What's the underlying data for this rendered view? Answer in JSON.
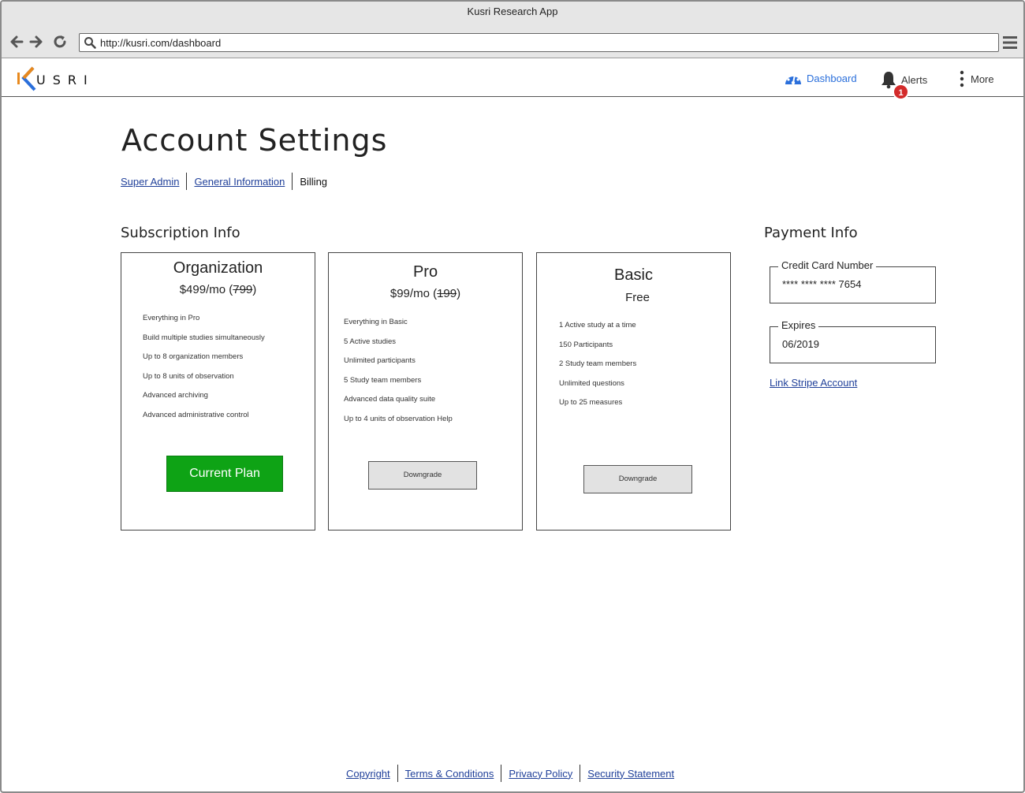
{
  "window": {
    "title": "Kusri Research App"
  },
  "browser": {
    "url": "http://kusri.com/dashboard"
  },
  "header": {
    "logo_text": "USRI",
    "dashboard_label": "Dashboard",
    "alerts_label": "Alerts",
    "alerts_count": "1",
    "more_label": "More"
  },
  "page": {
    "title": "Account Settings",
    "tabs": [
      {
        "label": "Super Admin"
      },
      {
        "label": "General Information"
      },
      {
        "label": "Billing"
      }
    ]
  },
  "subscription": {
    "heading": "Subscription Info",
    "plans": [
      {
        "name": "Organization",
        "price": "$499/mo (",
        "old_price": "799",
        "price_close": ")",
        "features": [
          "Everything in Pro",
          "Build multiple  studies simultaneously",
          "Up to 8 organization members",
          "Up to 8 units of observation",
          "Advanced archiving",
          "Advanced administrative control"
        ],
        "button": "Current Plan"
      },
      {
        "name": "Pro",
        "price": "$99/mo (",
        "old_price": "199",
        "price_close": ")",
        "features": [
          "Everything in Basic",
          "5 Active studies",
          "Unlimited participants",
          "5 Study team members",
          "Advanced data quality suite",
          "Up to 4 units of observation Help"
        ],
        "button": "Downgrade"
      },
      {
        "name": "Basic",
        "price": "Free",
        "features": [
          "1 Active study at a time",
          "150 Participants",
          "2 Study team members",
          "Unlimited questions",
          "Up to 25 measures"
        ],
        "button": "Downgrade"
      }
    ]
  },
  "payment": {
    "heading": "Payment Info",
    "card_label": "Credit Card Number",
    "card_value": "**** **** **** 7654",
    "expires_label": "Expires",
    "expires_value": "06/2019",
    "link_stripe": "Link Stripe Account"
  },
  "footer": {
    "links": [
      "Copyright",
      "Terms & Conditions",
      "Privacy Policy",
      "Security Statement"
    ]
  },
  "colors": {
    "accent_blue": "#2a6fdb",
    "link_blue": "#1f3f99",
    "current_plan_green": "#0ea315",
    "badge_red": "#d32b2b",
    "logo_orange": "#e8891d",
    "logo_blue": "#2a6fdb"
  }
}
